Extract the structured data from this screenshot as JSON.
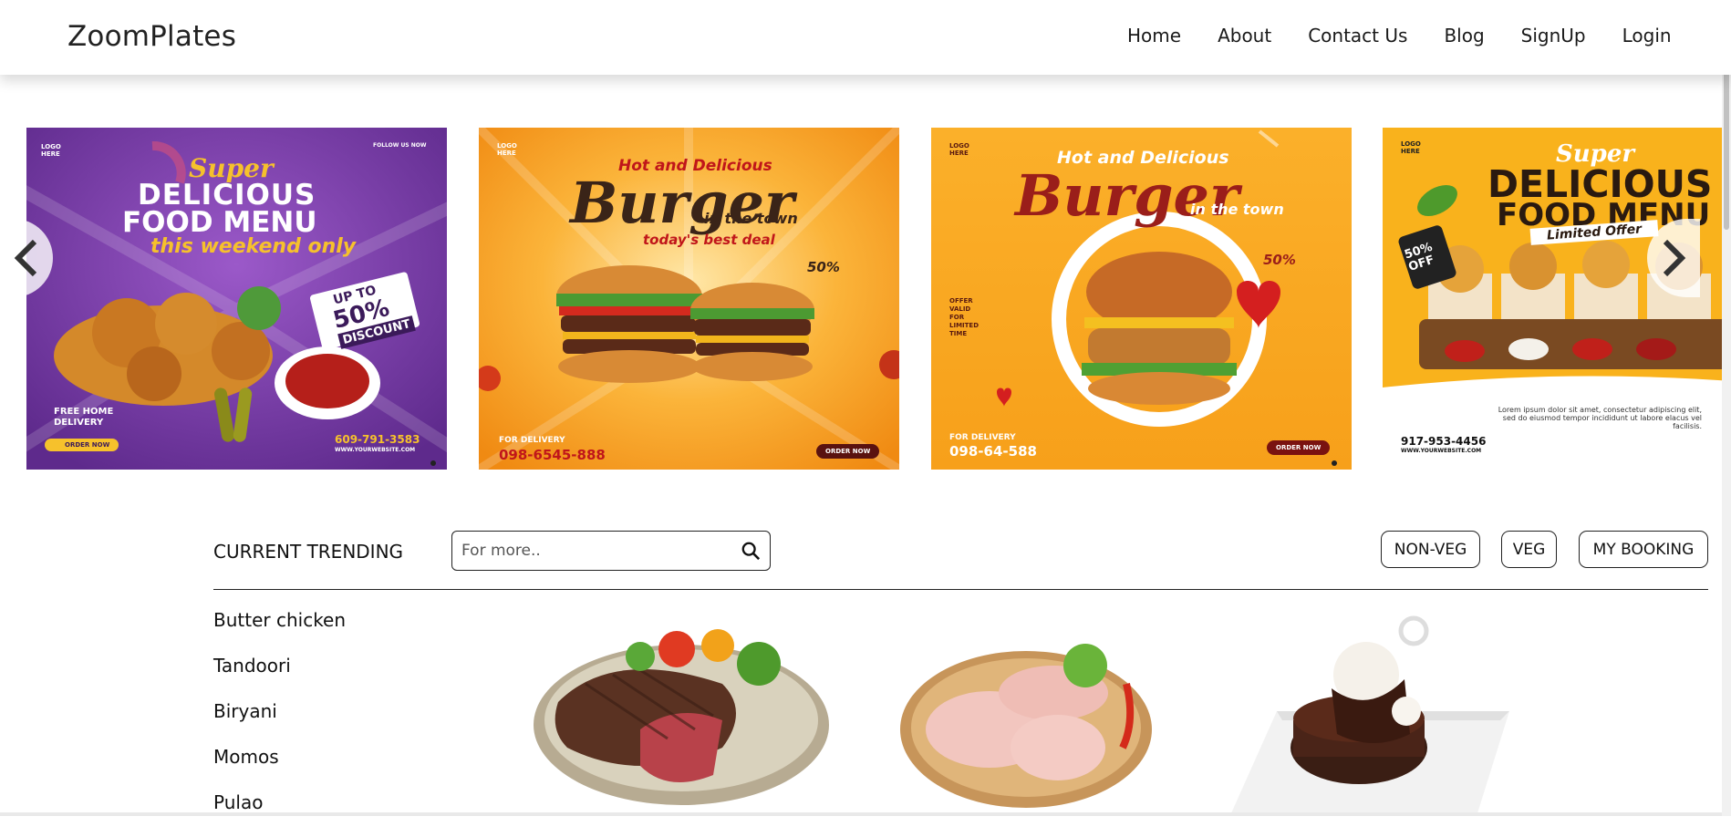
{
  "brand": "ZoomPlates",
  "nav": [
    "Home",
    "About",
    "Contact Us",
    "Blog",
    "SignUp",
    "Login"
  ],
  "slides": [
    {
      "logo": "LOGO HERE",
      "follow": "FOLLOW US NOW",
      "line1": "Super",
      "line2": "DELICIOUS",
      "line3": "FOOD MENU",
      "line4": "this weekend only",
      "badge_top": "UP TO",
      "badge_mid": "50%",
      "badge_bot": "DISCOUNT",
      "delivery": "FREE HOME DELIVERY",
      "order": "ORDER NOW",
      "phone": "609-791-3583",
      "site": "WWW.YOURWEBSITE.COM"
    },
    {
      "logo": "LOGO HERE",
      "tag": "Hot and Delicious",
      "title": "Burger",
      "sub": "in the town",
      "deal": "today's best deal",
      "save": "50%",
      "delivery": "FOR DELIVERY",
      "phone": "098-6545-888",
      "order": "ORDER NOW"
    },
    {
      "logo": "LOGO HERE",
      "tag": "Hot and Delicious",
      "title": "Burger",
      "sub": "in the town",
      "save": "50%",
      "offer": "OFFER VALID FOR LIMITED TIME",
      "delivery": "FOR DELIVERY",
      "phone": "098-64-588",
      "order": "ORDER NOW"
    },
    {
      "logo": "LOGO HERE",
      "line1": "Super",
      "line2": "DELICIOUS",
      "line3": "FOOD MENU",
      "ribbon": "Limited Offer",
      "disc": "50% OFF",
      "lorem": "Lorem ipsum dolor sit amet, consectetur adipiscing elit, sed do eiusmod tempor incididunt ut labore elacus vel facilisis.",
      "phone": "917-953-4456",
      "site": "WWW.YOURWEBSITE.COM"
    }
  ],
  "trending": {
    "title": "CURRENT TRENDING",
    "search_placeholder": "For more..",
    "buttons": [
      "NON-VEG",
      "VEG",
      "MY BOOKING"
    ],
    "items": [
      "Butter chicken",
      "Tandoori",
      "Biryani",
      "Momos",
      "Pulao"
    ]
  },
  "colors": {
    "purple": "#7b3fa9",
    "orange": "#f59a1e",
    "yellow": "#fbc02d",
    "burger_red": "#8b1a1a"
  },
  "icons": [
    "chevron-left-icon",
    "chevron-right-icon",
    "search-icon"
  ]
}
